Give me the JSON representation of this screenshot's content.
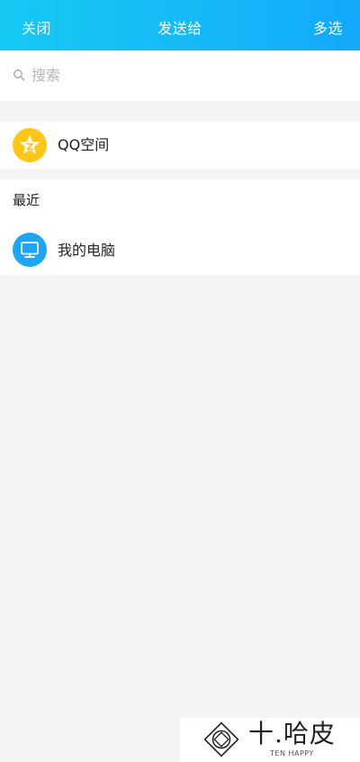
{
  "header": {
    "close_label": "关闭",
    "title": "发送给",
    "multiselect_label": "多选"
  },
  "search": {
    "placeholder": "搜索",
    "icon": "search-icon"
  },
  "qzone": {
    "label": "QQ空间",
    "icon": "qzone-star-icon",
    "color": "#ffc61a"
  },
  "recent": {
    "title": "最近",
    "items": [
      {
        "label": "我的电脑",
        "icon": "computer-monitor-icon",
        "color": "#1ea5f3"
      }
    ]
  },
  "watermark": {
    "brand": "十.哈皮",
    "subtitle": "TEN HAPPY"
  },
  "colors": {
    "header_gradient_start": "#15c9f4",
    "header_gradient_end": "#14a8fb",
    "background": "#f4f4f4"
  }
}
